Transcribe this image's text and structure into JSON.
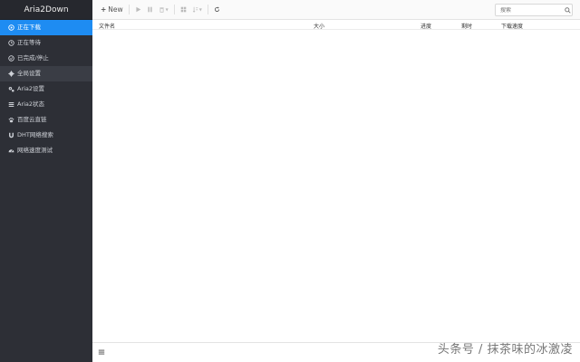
{
  "app": {
    "title": "Aria2Down"
  },
  "sidebar": {
    "items": [
      {
        "label": "正在下载",
        "icon": "play-circle-icon"
      },
      {
        "label": "正在等待",
        "icon": "clock-icon"
      },
      {
        "label": "已完成/停止",
        "icon": "check-circle-icon"
      },
      {
        "label": "全局设置",
        "icon": "gear-icon"
      },
      {
        "label": "Aria2设置",
        "icon": "gears-icon"
      },
      {
        "label": "Aria2状态",
        "icon": "list-icon"
      },
      {
        "label": "百度云直链",
        "icon": "paw-icon"
      },
      {
        "label": "DHT网络搜索",
        "icon": "magnet-icon"
      },
      {
        "label": "网络速度测试",
        "icon": "dashboard-icon"
      }
    ]
  },
  "toolbar": {
    "new_label": "New"
  },
  "search": {
    "placeholder": "搜索"
  },
  "table": {
    "columns": [
      "文件名",
      "大小",
      "进度",
      "剩时",
      "下载速度"
    ]
  },
  "watermark": {
    "text": "头条号 / 抹茶味的冰激凌"
  }
}
